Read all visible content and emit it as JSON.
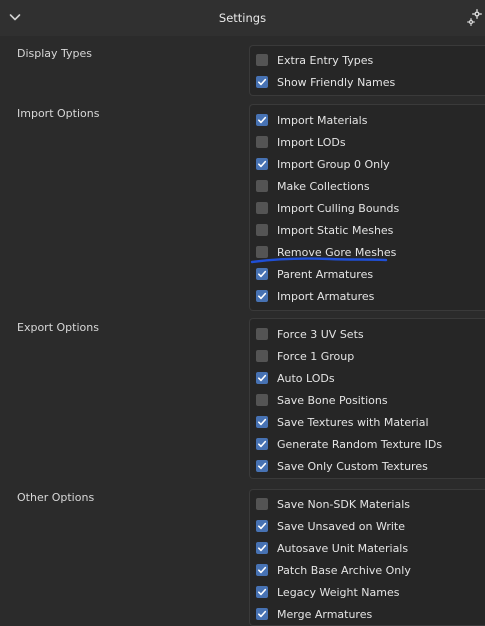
{
  "header": {
    "title": "Settings"
  },
  "sections": [
    {
      "label": "Display Types",
      "options": [
        {
          "label": "Extra Entry Types",
          "checked": false
        },
        {
          "label": "Show Friendly Names",
          "checked": true
        }
      ]
    },
    {
      "label": "Import Options",
      "options": [
        {
          "label": "Import Materials",
          "checked": true
        },
        {
          "label": "Import LODs",
          "checked": false
        },
        {
          "label": "Import Group 0 Only",
          "checked": true
        },
        {
          "label": "Make Collections",
          "checked": false
        },
        {
          "label": "Import Culling Bounds",
          "checked": false
        },
        {
          "label": "Import Static Meshes",
          "checked": false
        },
        {
          "label": "Remove Gore Meshes",
          "checked": false
        },
        {
          "label": "Parent Armatures",
          "checked": true
        },
        {
          "label": "Import Armatures",
          "checked": true
        }
      ]
    },
    {
      "label": "Export Options",
      "options": [
        {
          "label": "Force 3 UV Sets",
          "checked": false
        },
        {
          "label": "Force 1 Group",
          "checked": false
        },
        {
          "label": "Auto LODs",
          "checked": true
        },
        {
          "label": "Save Bone Positions",
          "checked": false
        },
        {
          "label": "Save Textures with Material",
          "checked": true
        },
        {
          "label": "Generate Random Texture IDs",
          "checked": true
        },
        {
          "label": "Save Only Custom Textures",
          "checked": true
        }
      ]
    },
    {
      "label": "Other Options",
      "options": [
        {
          "label": "Save Non-SDK Materials",
          "checked": false
        },
        {
          "label": "Save Unsaved on Write",
          "checked": true
        },
        {
          "label": "Autosave Unit Materials",
          "checked": true
        },
        {
          "label": "Patch Base Archive Only",
          "checked": true
        },
        {
          "label": "Legacy Weight Names",
          "checked": true
        },
        {
          "label": "Merge Armatures",
          "checked": true
        }
      ]
    }
  ],
  "icons": {
    "collapse": "chevron-down-icon",
    "settings": "gear-icon",
    "check": "checkmark-icon"
  },
  "colors": {
    "checked": "#4772b3",
    "unchecked": "#545454",
    "annotation": "#1f4fd6"
  }
}
